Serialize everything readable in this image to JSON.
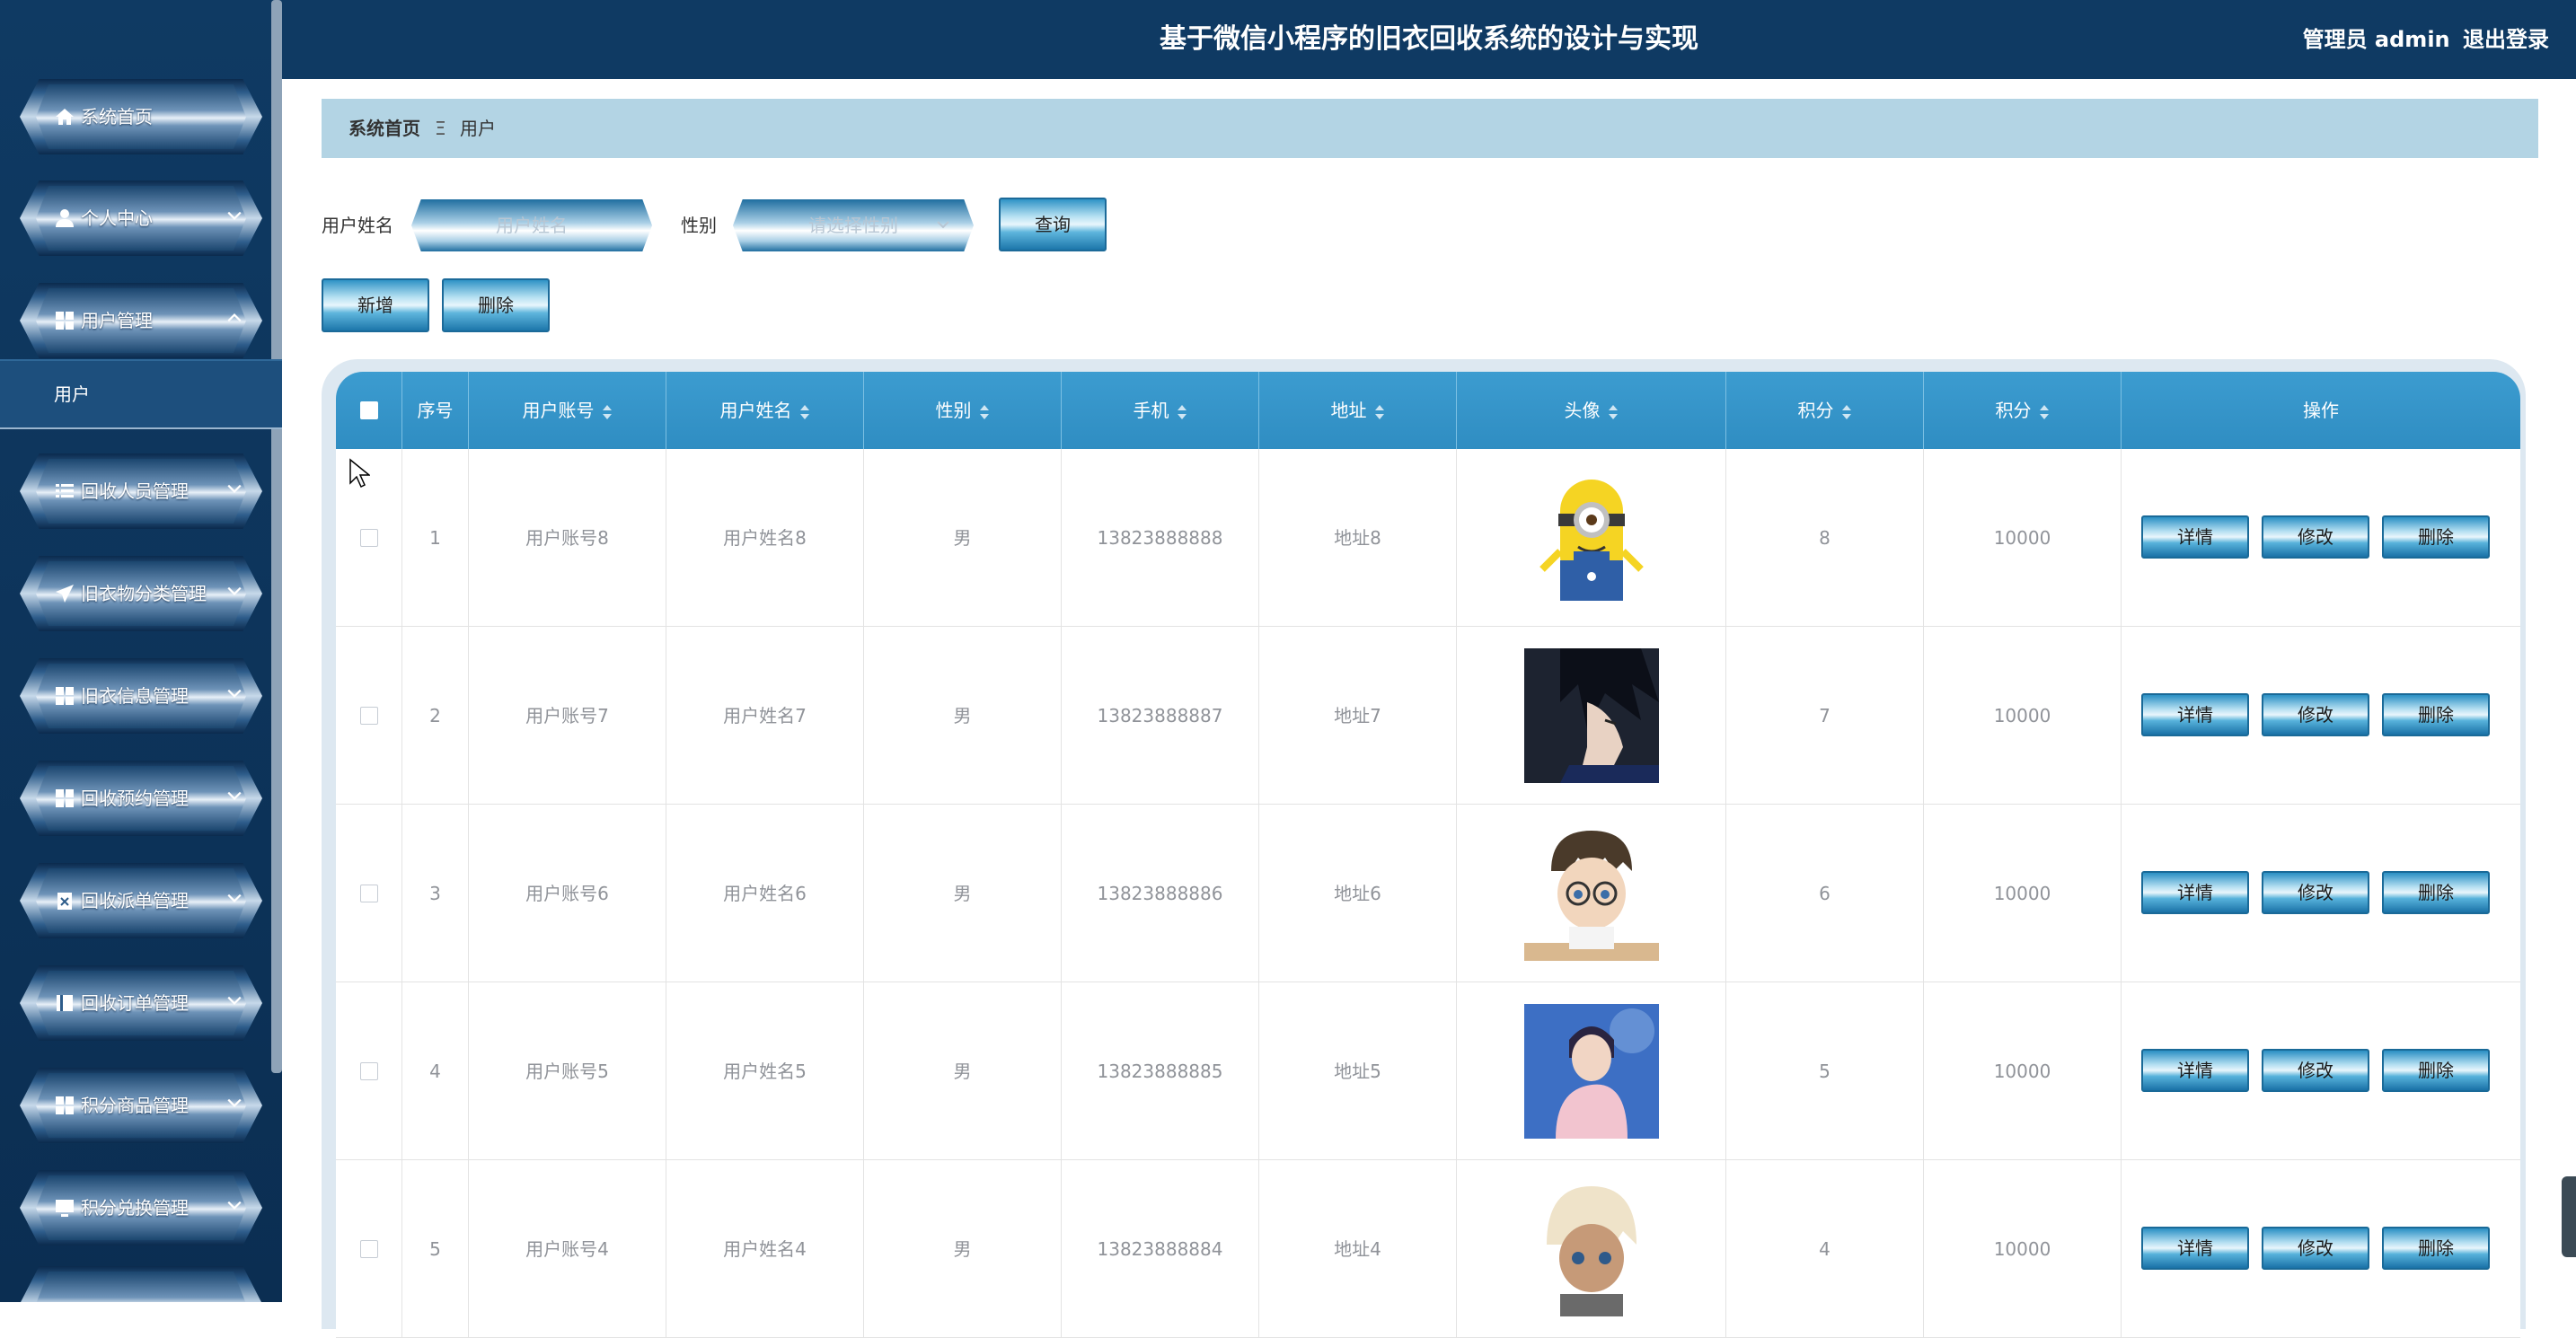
{
  "header": {
    "title": "基于微信小程序的旧衣回收系统的设计与实现",
    "user": "管理员 admin",
    "logout": "退出登录"
  },
  "sidebar": {
    "items": [
      {
        "label": "系统首页",
        "icon": "home-icon"
      },
      {
        "label": "个人中心",
        "icon": "user-icon"
      },
      {
        "label": "用户管理",
        "icon": "grid-icon"
      },
      {
        "label": "回收人员管理",
        "icon": "list-icon"
      },
      {
        "label": "旧衣物分类管理",
        "icon": "send-icon"
      },
      {
        "label": "旧衣信息管理",
        "icon": "grid-icon"
      },
      {
        "label": "回收预约管理",
        "icon": "grid-icon"
      },
      {
        "label": "回收派单管理",
        "icon": "clipboard-icon"
      },
      {
        "label": "回收订单管理",
        "icon": "book-icon"
      },
      {
        "label": "积分商品管理",
        "icon": "grid-icon"
      },
      {
        "label": "积分兑换管理",
        "icon": "monitor-icon"
      }
    ],
    "submenu": "用户"
  },
  "breadcrumb": {
    "home": "系统首页",
    "separator": "Ξ",
    "current": "用户"
  },
  "search": {
    "name_label": "用户姓名",
    "name_placeholder": "用户姓名",
    "gender_label": "性别",
    "gender_placeholder": "请选择性别",
    "query_button": "查询"
  },
  "actions": {
    "add": "新增",
    "delete": "删除"
  },
  "table": {
    "columns": [
      "序号",
      "用户账号",
      "用户姓名",
      "性别",
      "手机",
      "地址",
      "头像",
      "积分",
      "积分",
      "操作"
    ],
    "rows": [
      {
        "index": "1",
        "account": "用户账号8",
        "name": "用户姓名8",
        "gender": "男",
        "phone": "13823888888",
        "address": "地址8",
        "points": "8",
        "points2": "10000",
        "avatar": "minion"
      },
      {
        "index": "2",
        "account": "用户账号7",
        "name": "用户姓名7",
        "gender": "男",
        "phone": "13823888887",
        "address": "地址7",
        "points": "7",
        "points2": "10000",
        "avatar": "anime-dark-hair"
      },
      {
        "index": "3",
        "account": "用户账号6",
        "name": "用户姓名6",
        "gender": "男",
        "phone": "13823888886",
        "address": "地址6",
        "points": "6",
        "points2": "10000",
        "avatar": "anime-glasses"
      },
      {
        "index": "4",
        "account": "用户账号5",
        "name": "用户姓名5",
        "gender": "男",
        "phone": "13823888885",
        "address": "地址5",
        "points": "5",
        "points2": "10000",
        "avatar": "anime-pink-shirt"
      },
      {
        "index": "5",
        "account": "用户账号4",
        "name": "用户姓名4",
        "gender": "男",
        "phone": "13823888884",
        "address": "地址4",
        "points": "4",
        "points2": "10000",
        "avatar": "anime-blonde"
      }
    ],
    "row_actions": {
      "detail": "详情",
      "edit": "修改",
      "delete": "删除"
    }
  },
  "colors": {
    "primary_dark": "#0f3a63",
    "table_header": "#3399cc",
    "breadcrumb_bg": "#b3d4e4"
  }
}
